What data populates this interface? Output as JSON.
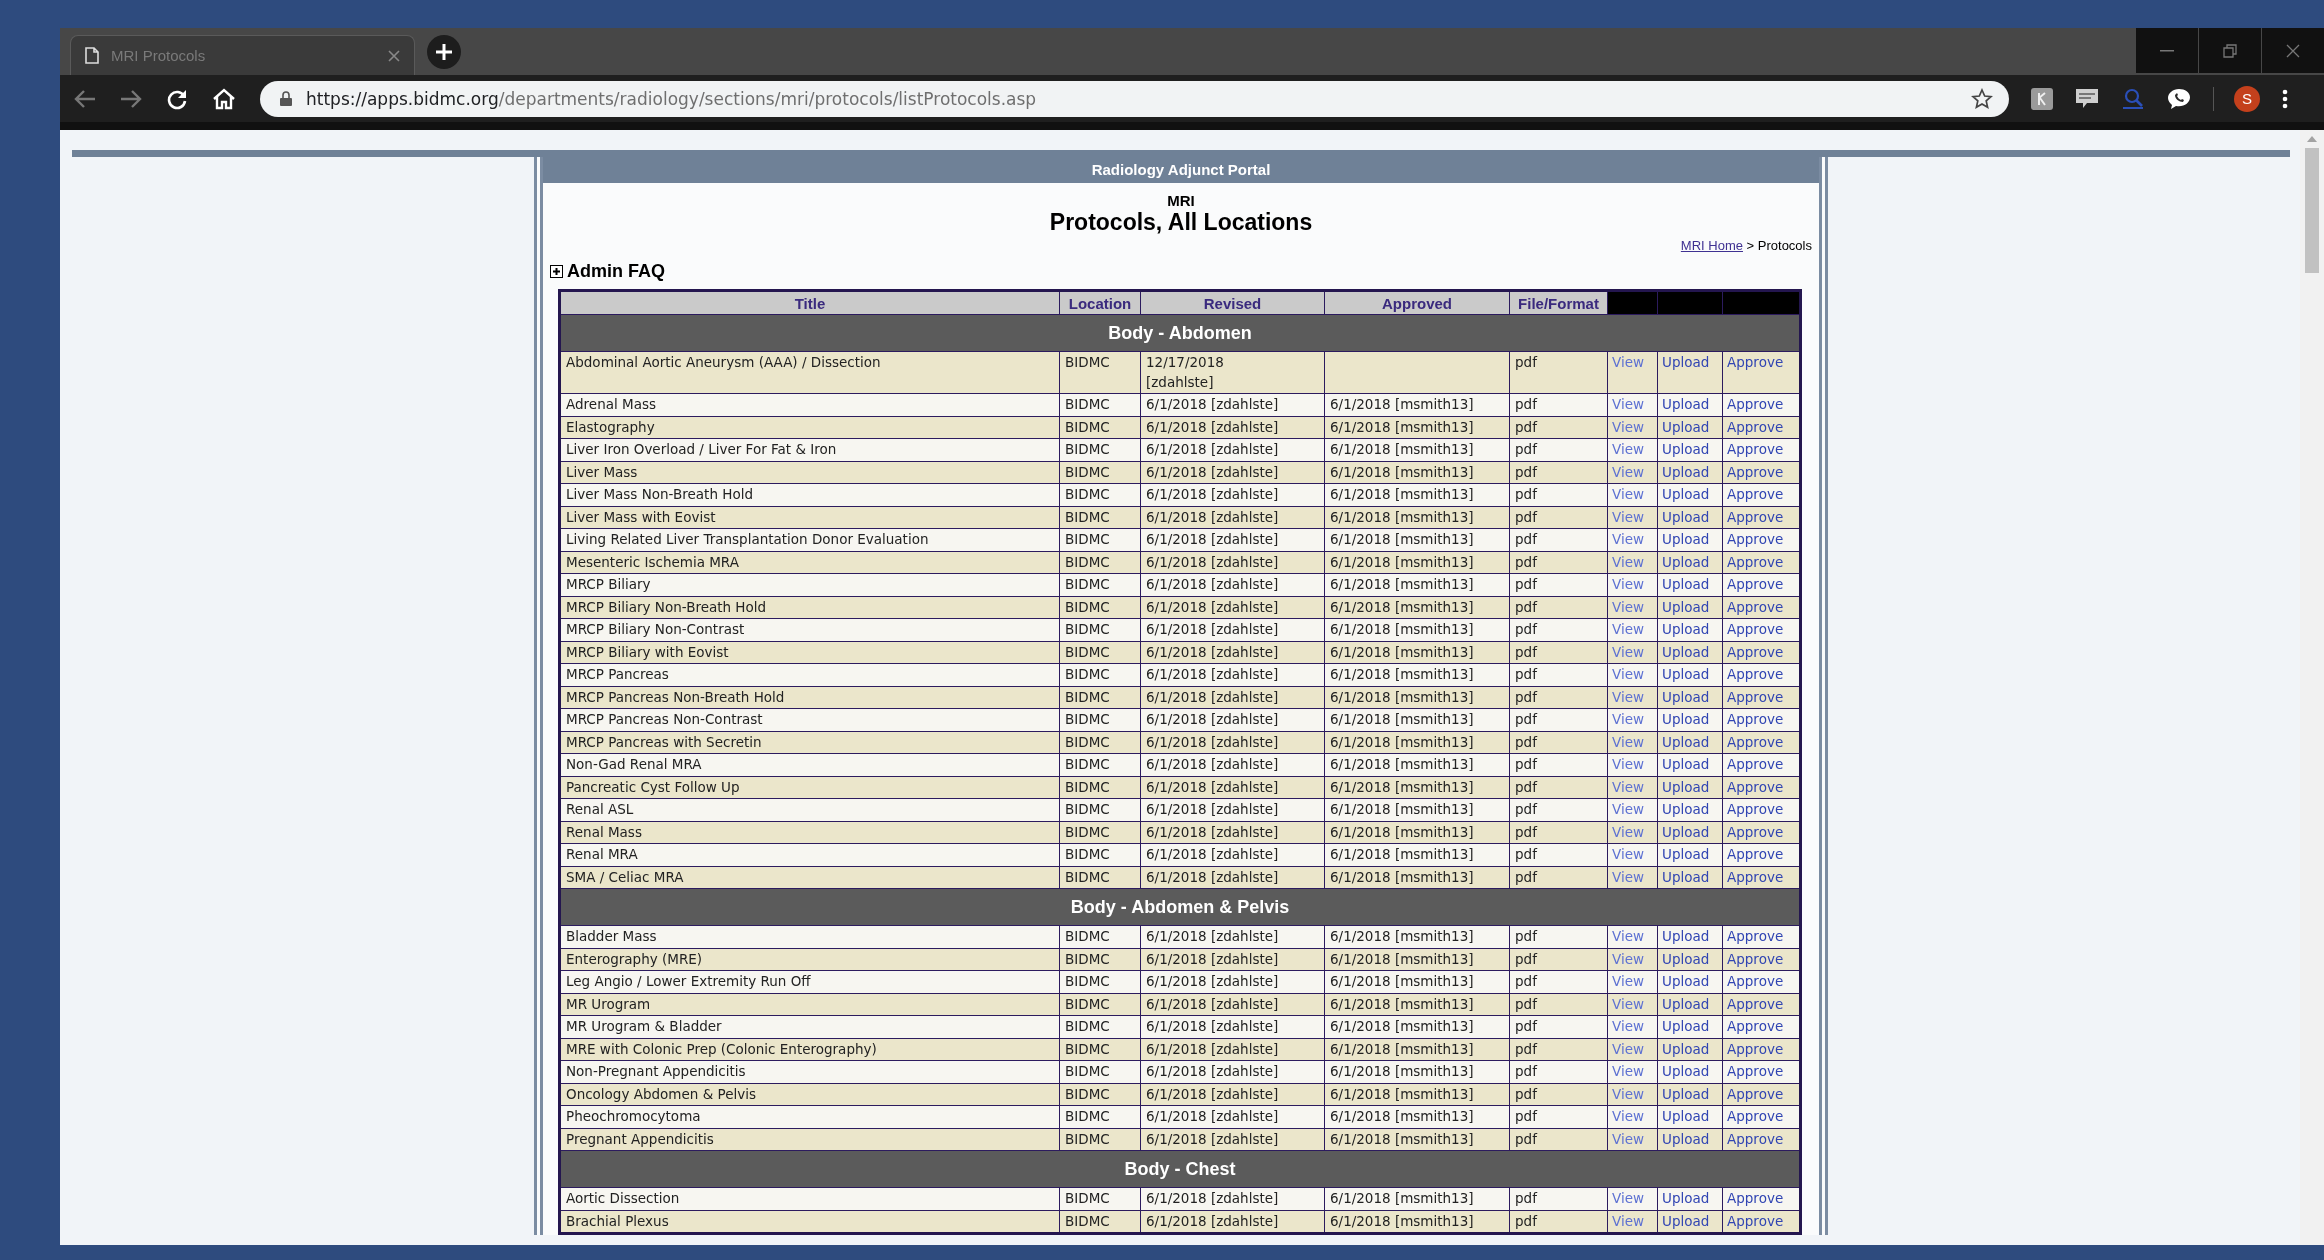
{
  "browser": {
    "tab_title": "MRI Protocols",
    "url_host": "https://apps.bidmc.org",
    "url_path": "/departments/radiology/sections/mri/protocols/listProtocols.asp",
    "profile_initial": "S"
  },
  "portal": {
    "banner": "Radiology Adjunct Portal",
    "section": "MRI",
    "heading": "Protocols, All Locations",
    "breadcrumb": {
      "link": "MRI Home",
      "rest": "> Protocols"
    }
  },
  "admin_faq": {
    "label": "Admin FAQ",
    "expanded": false
  },
  "table": {
    "columns": [
      "Title",
      "Location",
      "Revised",
      "Approved",
      "File/Format"
    ],
    "sections": [
      {
        "title": "Body - Abdomen",
        "rows": [
          {
            "title": "Abdominal Aortic Aneurysm (AAA) / Dissection",
            "location": "BIDMC",
            "revised": "12/17/2018 [zdahlste]",
            "format": "pdf",
            "view": "View",
            "upload": "Upload",
            "approve": "Approve",
            "shaded": true
          },
          {
            "title": "Adrenal Mass",
            "location": "BIDMC",
            "revised": "6/1/2018 [zdahlste]",
            "approved": "6/1/2018 [msmith13]",
            "format": "pdf",
            "view": "View",
            "upload": "Upload",
            "approve": "Approve",
            "shaded": false
          },
          {
            "title": "Elastography",
            "location": "BIDMC",
            "revised": "6/1/2018 [zdahlste]",
            "approved": "6/1/2018 [msmith13]",
            "format": "pdf",
            "view": "View",
            "upload": "Upload",
            "approve": "Approve",
            "shaded": true
          },
          {
            "title": "Liver Iron Overload / Liver For Fat & Iron",
            "location": "BIDMC",
            "revised": "6/1/2018 [zdahlste]",
            "approved": "6/1/2018 [msmith13]",
            "format": "pdf",
            "view": "View",
            "upload": "Upload",
            "approve": "Approve",
            "shaded": false
          },
          {
            "title": "Liver Mass",
            "location": "BIDMC",
            "revised": "6/1/2018 [zdahlste]",
            "approved": "6/1/2018 [msmith13]",
            "format": "pdf",
            "view": "View",
            "upload": "Upload",
            "approve": "Approve",
            "shaded": true
          },
          {
            "title": "Liver Mass Non-Breath Hold",
            "location": "BIDMC",
            "revised": "6/1/2018 [zdahlste]",
            "approved": "6/1/2018 [msmith13]",
            "format": "pdf",
            "view": "View",
            "upload": "Upload",
            "approve": "Approve",
            "shaded": false
          },
          {
            "title": "Liver Mass with Eovist",
            "location": "BIDMC",
            "revised": "6/1/2018 [zdahlste]",
            "approved": "6/1/2018 [msmith13]",
            "format": "pdf",
            "view": "View",
            "upload": "Upload",
            "approve": "Approve",
            "shaded": true
          },
          {
            "title": "Living Related Liver Transplantation Donor Evaluation",
            "location": "BIDMC",
            "revised": "6/1/2018 [zdahlste]",
            "approved": "6/1/2018 [msmith13]",
            "format": "pdf",
            "view": "View",
            "upload": "Upload",
            "approve": "Approve",
            "shaded": false
          },
          {
            "title": "Mesenteric Ischemia MRA",
            "location": "BIDMC",
            "revised": "6/1/2018 [zdahlste]",
            "approved": "6/1/2018 [msmith13]",
            "format": "pdf",
            "view": "View",
            "upload": "Upload",
            "approve": "Approve",
            "shaded": true
          },
          {
            "title": "MRCP Biliary",
            "location": "BIDMC",
            "revised": "6/1/2018 [zdahlste]",
            "approved": "6/1/2018 [msmith13]",
            "format": "pdf",
            "view": "View",
            "upload": "Upload",
            "approve": "Approve",
            "shaded": false
          },
          {
            "title": "MRCP Biliary Non-Breath Hold",
            "location": "BIDMC",
            "revised": "6/1/2018 [zdahlste]",
            "approved": "6/1/2018 [msmith13]",
            "format": "pdf",
            "view": "View",
            "upload": "Upload",
            "approve": "Approve",
            "shaded": true
          },
          {
            "title": "MRCP Biliary Non-Contrast",
            "location": "BIDMC",
            "revised": "6/1/2018 [zdahlste]",
            "approved": "6/1/2018 [msmith13]",
            "format": "pdf",
            "view": "View",
            "upload": "Upload",
            "approve": "Approve",
            "shaded": false
          },
          {
            "title": "MRCP Biliary with Eovist",
            "location": "BIDMC",
            "revised": "6/1/2018 [zdahlste]",
            "approved": "6/1/2018 [msmith13]",
            "format": "pdf",
            "view": "View",
            "upload": "Upload",
            "approve": "Approve",
            "shaded": true
          },
          {
            "title": "MRCP Pancreas",
            "location": "BIDMC",
            "revised": "6/1/2018 [zdahlste]",
            "approved": "6/1/2018 [msmith13]",
            "format": "pdf",
            "view": "View",
            "upload": "Upload",
            "approve": "Approve",
            "shaded": false
          },
          {
            "title": "MRCP Pancreas Non-Breath Hold",
            "location": "BIDMC",
            "revised": "6/1/2018 [zdahlste]",
            "approved": "6/1/2018 [msmith13]",
            "format": "pdf",
            "view": "View",
            "upload": "Upload",
            "approve": "Approve",
            "shaded": true
          },
          {
            "title": "MRCP Pancreas Non-Contrast",
            "location": "BIDMC",
            "revised": "6/1/2018 [zdahlste]",
            "approved": "6/1/2018 [msmith13]",
            "format": "pdf",
            "view": "View",
            "upload": "Upload",
            "approve": "Approve",
            "shaded": false
          },
          {
            "title": "MRCP Pancreas with Secretin",
            "location": "BIDMC",
            "revised": "6/1/2018 [zdahlste]",
            "approved": "6/1/2018 [msmith13]",
            "format": "pdf",
            "view": "View",
            "upload": "Upload",
            "approve": "Approve",
            "shaded": true
          },
          {
            "title": "Non-Gad Renal MRA",
            "location": "BIDMC",
            "revised": "6/1/2018 [zdahlste]",
            "approved": "6/1/2018 [msmith13]",
            "format": "pdf",
            "view": "View",
            "upload": "Upload",
            "approve": "Approve",
            "shaded": false
          },
          {
            "title": "Pancreatic Cyst Follow Up",
            "location": "BIDMC",
            "revised": "6/1/2018 [zdahlste]",
            "approved": "6/1/2018 [msmith13]",
            "format": "pdf",
            "view": "View",
            "upload": "Upload",
            "approve": "Approve",
            "shaded": true
          },
          {
            "title": "Renal ASL",
            "location": "BIDMC",
            "revised": "6/1/2018 [zdahlste]",
            "approved": "6/1/2018 [msmith13]",
            "format": "pdf",
            "view": "View",
            "upload": "Upload",
            "approve": "Approve",
            "shaded": false
          },
          {
            "title": "Renal Mass",
            "location": "BIDMC",
            "revised": "6/1/2018 [zdahlste]",
            "approved": "6/1/2018 [msmith13]",
            "format": "pdf",
            "view": "View",
            "upload": "Upload",
            "approve": "Approve",
            "shaded": true
          },
          {
            "title": "Renal MRA",
            "location": "BIDMC",
            "revised": "6/1/2018 [zdahlste]",
            "approved": "6/1/2018 [msmith13]",
            "format": "pdf",
            "view": "View",
            "upload": "Upload",
            "approve": "Approve",
            "shaded": false
          },
          {
            "title": "SMA / Celiac MRA",
            "location": "BIDMC",
            "revised": "6/1/2018 [zdahlste]",
            "approved": "6/1/2018 [msmith13]",
            "format": "pdf",
            "view": "View",
            "upload": "Upload",
            "approve": "Approve",
            "shaded": true
          }
        ]
      },
      {
        "title": "Body - Abdomen & Pelvis",
        "rows": [
          {
            "title": "Bladder Mass",
            "location": "BIDMC",
            "revised": "6/1/2018 [zdahlste]",
            "approved": "6/1/2018 [msmith13]",
            "format": "pdf",
            "view": "View",
            "upload": "Upload",
            "approve": "Approve",
            "shaded": false
          },
          {
            "title": "Enterography (MRE)",
            "location": "BIDMC",
            "revised": "6/1/2018 [zdahlste]",
            "approved": "6/1/2018 [msmith13]",
            "format": "pdf",
            "view": "View",
            "upload": "Upload",
            "approve": "Approve",
            "shaded": true
          },
          {
            "title": "Leg Angio / Lower Extremity Run Off",
            "location": "BIDMC",
            "revised": "6/1/2018 [zdahlste]",
            "approved": "6/1/2018 [msmith13]",
            "format": "pdf",
            "view": "View",
            "upload": "Upload",
            "approve": "Approve",
            "shaded": false
          },
          {
            "title": "MR Urogram",
            "location": "BIDMC",
            "revised": "6/1/2018 [zdahlste]",
            "approved": "6/1/2018 [msmith13]",
            "format": "pdf",
            "view": "View",
            "upload": "Upload",
            "approve": "Approve",
            "shaded": true
          },
          {
            "title": "MR Urogram & Bladder",
            "location": "BIDMC",
            "revised": "6/1/2018 [zdahlste]",
            "approved": "6/1/2018 [msmith13]",
            "format": "pdf",
            "view": "View",
            "upload": "Upload",
            "approve": "Approve",
            "shaded": false
          },
          {
            "title": "MRE with Colonic Prep (Colonic Enterography)",
            "location": "BIDMC",
            "revised": "6/1/2018 [zdahlste]",
            "approved": "6/1/2018 [msmith13]",
            "format": "pdf",
            "view": "View",
            "upload": "Upload",
            "approve": "Approve",
            "shaded": true
          },
          {
            "title": "Non-Pregnant Appendicitis",
            "location": "BIDMC",
            "revised": "6/1/2018 [zdahlste]",
            "approved": "6/1/2018 [msmith13]",
            "format": "pdf",
            "view": "View",
            "upload": "Upload",
            "approve": "Approve",
            "shaded": false
          },
          {
            "title": "Oncology Abdomen & Pelvis",
            "location": "BIDMC",
            "revised": "6/1/2018 [zdahlste]",
            "approved": "6/1/2018 [msmith13]",
            "format": "pdf",
            "view": "View",
            "upload": "Upload",
            "approve": "Approve",
            "shaded": true
          },
          {
            "title": "Pheochromocytoma",
            "location": "BIDMC",
            "revised": "6/1/2018 [zdahlste]",
            "approved": "6/1/2018 [msmith13]",
            "format": "pdf",
            "view": "View",
            "upload": "Upload",
            "approve": "Approve",
            "shaded": false
          },
          {
            "title": "Pregnant Appendicitis",
            "location": "BIDMC",
            "revised": "6/1/2018 [zdahlste]",
            "approved": "6/1/2018 [msmith13]",
            "format": "pdf",
            "view": "View",
            "upload": "Upload",
            "approve": "Approve",
            "shaded": true
          }
        ]
      },
      {
        "title": "Body - Chest",
        "rows": [
          {
            "title": "Aortic Dissection",
            "location": "BIDMC",
            "revised": "6/1/2018 [zdahlste]",
            "approved": "6/1/2018 [msmith13]",
            "format": "pdf",
            "view": "View",
            "upload": "Upload",
            "approve": "Approve",
            "shaded": false
          },
          {
            "title": "Brachial Plexus",
            "location": "BIDMC",
            "revised": "6/1/2018 [zdahlste]",
            "approved": "6/1/2018 [msmith13]",
            "format": "pdf",
            "view": "View",
            "upload": "Upload",
            "approve": "Approve",
            "shaded": true
          }
        ]
      }
    ]
  }
}
